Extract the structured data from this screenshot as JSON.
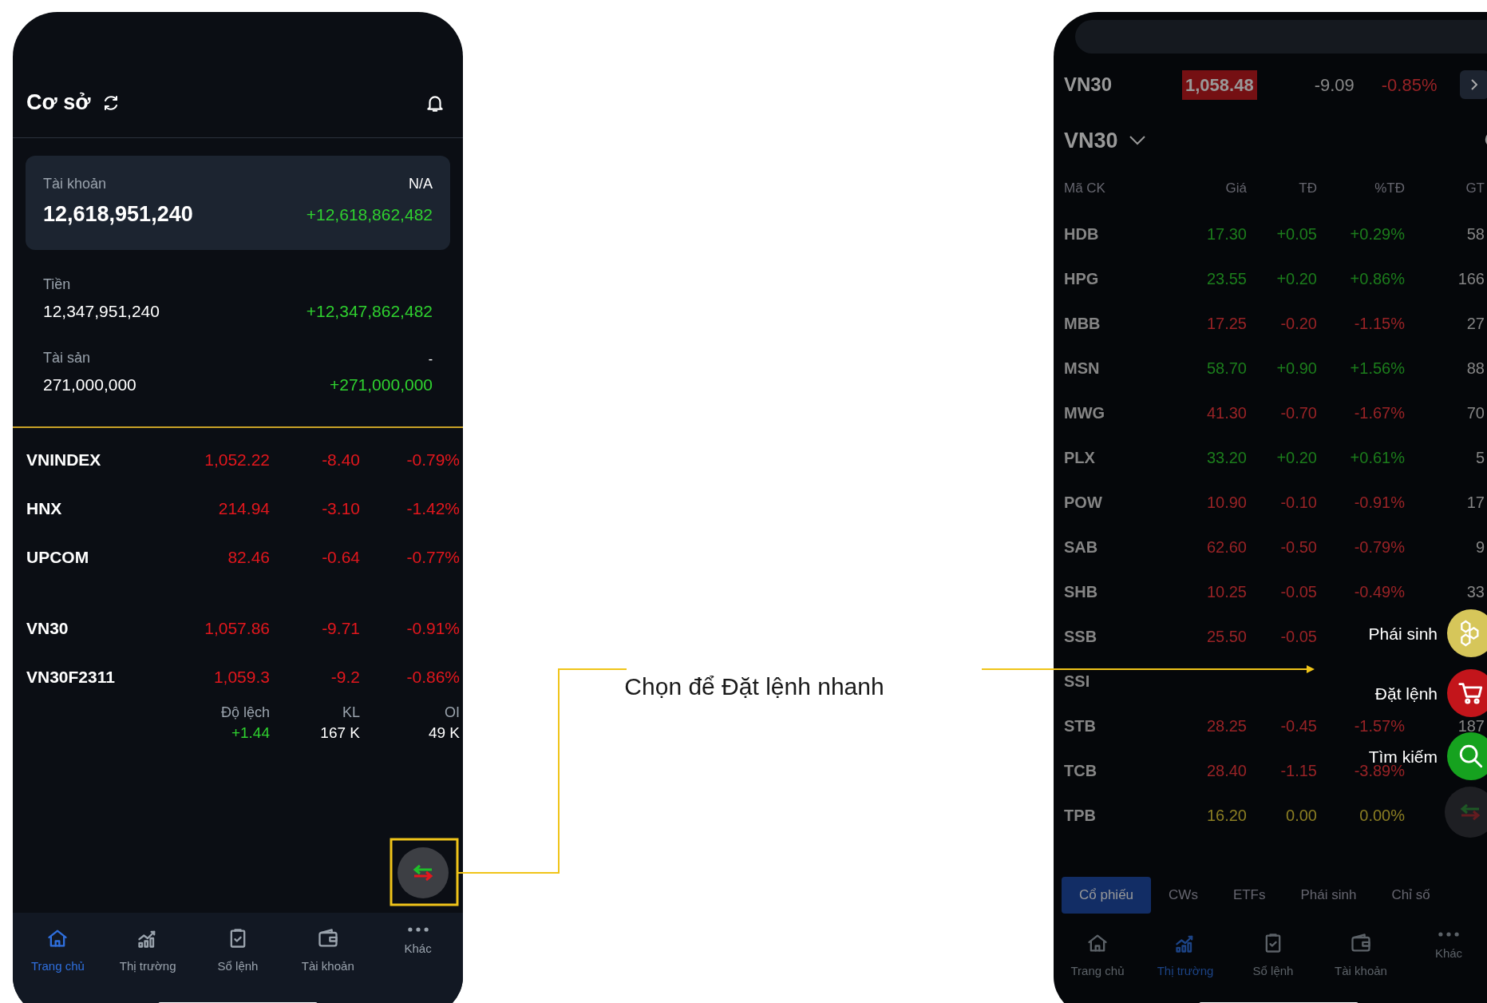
{
  "left_phone": {
    "header": {
      "title": "Cơ sở"
    },
    "account_card": {
      "label": "Tài khoản",
      "value": "12,618,951,240",
      "status": "N/A",
      "change": "+12,618,862,482"
    },
    "balances": [
      {
        "label": "Tiền",
        "value": "12,347,951,240",
        "change": "+12,347,862,482"
      },
      {
        "label": "Tài sản",
        "value": "271,000,000",
        "side": "-",
        "change": "+271,000,000"
      }
    ],
    "indices": [
      {
        "name": "VNINDEX",
        "value": "1,052.22",
        "change": "-8.40",
        "percent": "-0.79%",
        "color": "#e3171d"
      },
      {
        "name": "HNX",
        "value": "214.94",
        "change": "-3.10",
        "percent": "-1.42%",
        "color": "#e3171d"
      },
      {
        "name": "UPCOM",
        "value": "82.46",
        "change": "-0.64",
        "percent": "-0.77%",
        "color": "#e3171d"
      }
    ],
    "derivatives": [
      {
        "name": "VN30",
        "value": "1,057.86",
        "change": "-9.71",
        "percent": "-0.91%",
        "color": "#e3171d"
      },
      {
        "name": "VN30F2311",
        "value": "1,059.3",
        "change": "-9.2",
        "percent": "-0.86%",
        "color": "#e3171d"
      }
    ],
    "derivative_stats": [
      {
        "label": "Độ lệch",
        "value": "+1.44",
        "color": "#2fd12f"
      },
      {
        "label": "KL",
        "value": "167 K",
        "color": "#ffffff"
      },
      {
        "label": "OI",
        "value": "49 K",
        "color": "#ffffff"
      }
    ],
    "bottom_nav": [
      {
        "label": "Trang chủ",
        "selected": true
      },
      {
        "label": "Thị trường",
        "selected": false
      },
      {
        "label": "Sổ lệnh",
        "selected": false
      },
      {
        "label": "Tài khoản",
        "selected": false
      },
      {
        "label": "Khác",
        "selected": false
      }
    ]
  },
  "annotation": {
    "text": "Chọn để Đặt lệnh nhanh"
  },
  "right_phone": {
    "index_bar": {
      "name": "VN30",
      "value": "1,058.48",
      "change": "-9.09",
      "percent": "-0.85%"
    },
    "watchlist": {
      "title": "VN30"
    },
    "columns": [
      "Mã CK",
      "Giá",
      "TĐ",
      "%TĐ",
      "GT"
    ],
    "rows": [
      {
        "symbol": "HDB",
        "price": "17.30",
        "change": "+0.05",
        "percent": "+0.29%",
        "value": "58",
        "color": "#1c7d1c"
      },
      {
        "symbol": "HPG",
        "price": "23.55",
        "change": "+0.20",
        "percent": "+0.86%",
        "value": "166",
        "color": "#1c7d1c"
      },
      {
        "symbol": "MBB",
        "price": "17.25",
        "change": "-0.20",
        "percent": "-1.15%",
        "value": "27",
        "color": "#992326"
      },
      {
        "symbol": "MSN",
        "price": "58.70",
        "change": "+0.90",
        "percent": "+1.56%",
        "value": "88",
        "color": "#1c7d1c"
      },
      {
        "symbol": "MWG",
        "price": "41.30",
        "change": "-0.70",
        "percent": "-1.67%",
        "value": "70",
        "color": "#992326"
      },
      {
        "symbol": "PLX",
        "price": "33.20",
        "change": "+0.20",
        "percent": "+0.61%",
        "value": "5",
        "color": "#1c7d1c"
      },
      {
        "symbol": "POW",
        "price": "10.90",
        "change": "-0.10",
        "percent": "-0.91%",
        "value": "17",
        "color": "#992326"
      },
      {
        "symbol": "SAB",
        "price": "62.60",
        "change": "-0.50",
        "percent": "-0.79%",
        "value": "9",
        "color": "#992326"
      },
      {
        "symbol": "SHB",
        "price": "10.25",
        "change": "-0.05",
        "percent": "-0.49%",
        "value": "33",
        "color": "#992326"
      },
      {
        "symbol": "SSB",
        "price": "25.50",
        "change": "-0.05",
        "color": "#992326"
      },
      {
        "symbol": "SSI"
      },
      {
        "symbol": "STB",
        "price": "28.25",
        "change": "-0.45",
        "percent": "-1.57%",
        "value": "187",
        "color": "#992326"
      },
      {
        "symbol": "TCB",
        "price": "28.40",
        "change": "-1.15",
        "percent": "-3.89%",
        "color": "#992326"
      },
      {
        "symbol": "TPB",
        "price": "16.20",
        "change": "0.00",
        "percent": "0.00%",
        "color": "#8b7e23"
      }
    ],
    "tabs": [
      {
        "label": "Cổ phiếu",
        "selected": true
      },
      {
        "label": "CWs",
        "selected": false
      },
      {
        "label": "ETFs",
        "selected": false
      },
      {
        "label": "Phái sinh",
        "selected": false
      },
      {
        "label": "Chỉ số",
        "selected": false
      }
    ],
    "bottom_nav": [
      {
        "label": "Trang chủ",
        "selected": false
      },
      {
        "label": "Thị trường",
        "selected": true
      },
      {
        "label": "Sổ lệnh",
        "selected": false
      },
      {
        "label": "Tài khoản",
        "selected": false
      },
      {
        "label": "Khác",
        "selected": false
      }
    ],
    "quick_menu": [
      {
        "label": "Phái sinh",
        "color": "#d6c65a"
      },
      {
        "label": "Đặt lệnh",
        "color": "#c3151b"
      },
      {
        "label": "Tìm kiếm",
        "color": "#16a21f"
      }
    ]
  }
}
